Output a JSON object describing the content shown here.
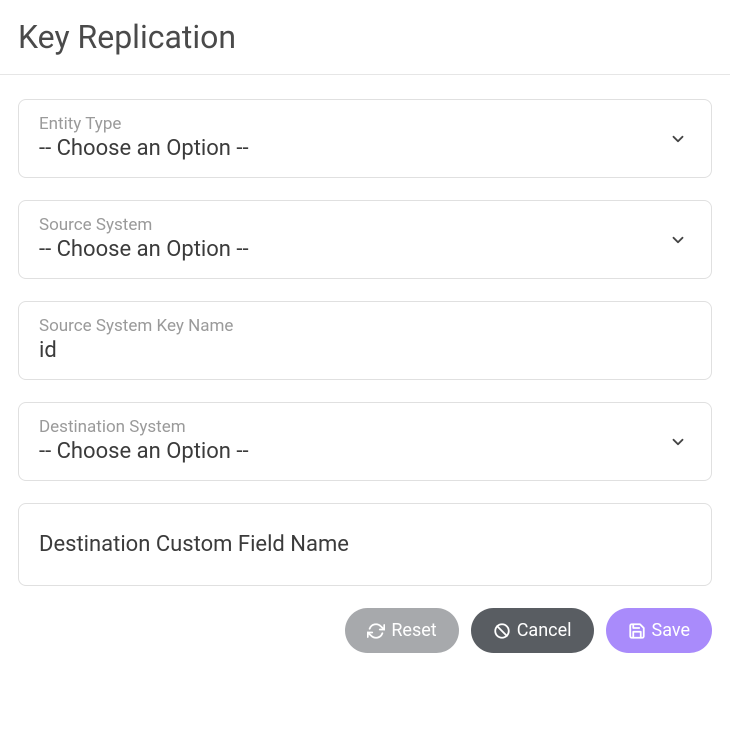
{
  "page": {
    "title": "Key Replication"
  },
  "fields": {
    "entityType": {
      "label": "Entity Type",
      "value": "-- Choose an Option --"
    },
    "sourceSystem": {
      "label": "Source System",
      "value": "-- Choose an Option --"
    },
    "sourceSystemKeyName": {
      "label": "Source System Key Name",
      "value": "id"
    },
    "destinationSystem": {
      "label": "Destination System",
      "value": "-- Choose an Option --"
    },
    "destinationCustomFieldName": {
      "placeholder": "Destination Custom Field Name",
      "value": ""
    }
  },
  "actions": {
    "reset": "Reset",
    "cancel": "Cancel",
    "save": "Save"
  }
}
